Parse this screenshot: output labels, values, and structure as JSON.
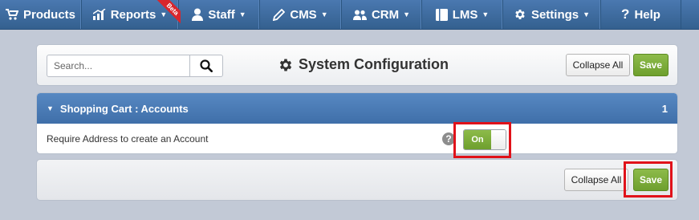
{
  "nav": {
    "items": [
      {
        "label": "Products",
        "icon": "cart-icon",
        "caret": false
      },
      {
        "label": "Reports",
        "icon": "chart-icon",
        "caret": true,
        "badge": "Beta"
      },
      {
        "label": "Staff",
        "icon": "user-icon",
        "caret": true
      },
      {
        "label": "CMS",
        "icon": "pencil-icon",
        "caret": true
      },
      {
        "label": "CRM",
        "icon": "users-icon",
        "caret": true
      },
      {
        "label": "LMS",
        "icon": "book-icon",
        "caret": true
      },
      {
        "label": "Settings",
        "icon": "gear-icon",
        "caret": true
      },
      {
        "label": "Help",
        "icon": "question-icon",
        "caret": false
      }
    ]
  },
  "header": {
    "search_placeholder": "Search...",
    "title": "System Configuration",
    "collapse_all": "Collapse All",
    "save": "Save"
  },
  "section": {
    "title": "Shopping Cart : Accounts",
    "count": "1",
    "setting_label": "Require Address to create an Account",
    "help_glyph": "?",
    "toggle_value": "On"
  },
  "footer": {
    "collapse_all": "Collapse All",
    "save": "Save"
  },
  "colors": {
    "nav": "#3f6ca3",
    "section_header": "#4a7bb8",
    "save_green": "#7aab37",
    "highlight": "#e0121a"
  }
}
